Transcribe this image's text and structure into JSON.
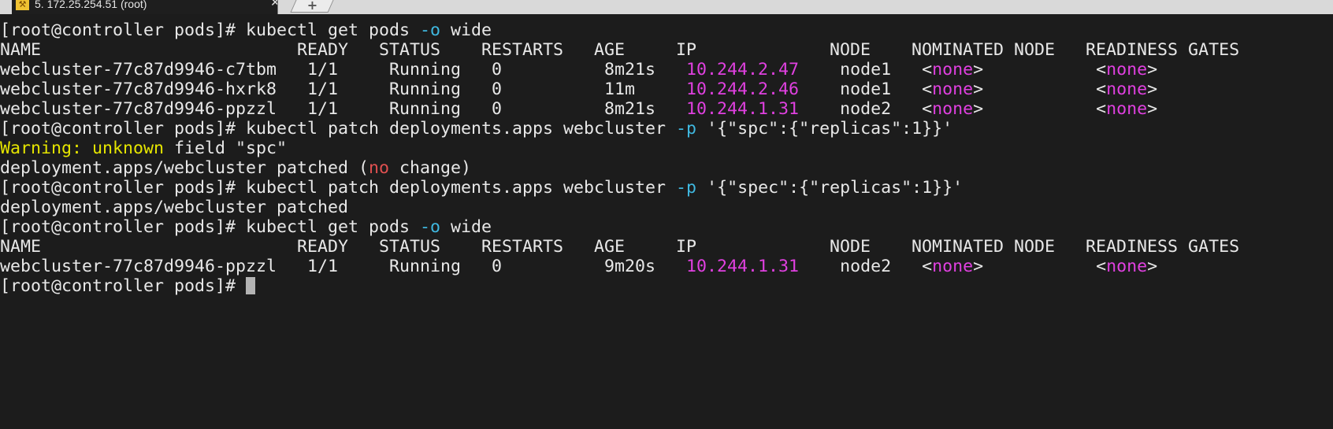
{
  "tab": {
    "title": "5. 172.25.254.51 (root)",
    "icon": "wrench-icon",
    "close": "✕",
    "new": "+"
  },
  "colors": {
    "background": "#1c1c1c",
    "text": "#e8e8e8",
    "ip": "#e040e0",
    "flag": "#3fb8e0",
    "warning": "#e5e500",
    "error": "#e05050"
  },
  "terminal": {
    "lines": [
      {
        "name": "command-line",
        "segments": [
          {
            "t": "[root@controller pods]# kubectl get pods "
          },
          {
            "t": "-o",
            "c": "cyan"
          },
          {
            "t": " wide"
          }
        ]
      },
      {
        "name": "table-header",
        "segments": [
          {
            "t": "NAME                         READY   STATUS    RESTARTS   AGE     IP             NODE    NOMINATED NODE   READINESS GATES"
          }
        ]
      },
      {
        "name": "pod-row",
        "segments": [
          {
            "t": "webcluster-77c87d9946-c7tbm   1/1     Running   0          8m21s   "
          },
          {
            "t": "10.244.2.47",
            "c": "magenta"
          },
          {
            "t": "    node1   <"
          },
          {
            "t": "none",
            "c": "magenta"
          },
          {
            "t": ">           <"
          },
          {
            "t": "none",
            "c": "magenta"
          },
          {
            "t": ">"
          }
        ]
      },
      {
        "name": "pod-row",
        "segments": [
          {
            "t": "webcluster-77c87d9946-hxrk8   1/1     Running   0          11m     "
          },
          {
            "t": "10.244.2.46",
            "c": "magenta"
          },
          {
            "t": "    node1   <"
          },
          {
            "t": "none",
            "c": "magenta"
          },
          {
            "t": ">           <"
          },
          {
            "t": "none",
            "c": "magenta"
          },
          {
            "t": ">"
          }
        ]
      },
      {
        "name": "pod-row",
        "segments": [
          {
            "t": "webcluster-77c87d9946-ppzzl   1/1     Running   0          8m21s   "
          },
          {
            "t": "10.244.1.31",
            "c": "magenta"
          },
          {
            "t": "    node2   <"
          },
          {
            "t": "none",
            "c": "magenta"
          },
          {
            "t": ">           <"
          },
          {
            "t": "none",
            "c": "magenta"
          },
          {
            "t": ">"
          }
        ]
      },
      {
        "name": "command-line",
        "segments": [
          {
            "t": "[root@controller pods]# kubectl patch deployments.apps webcluster "
          },
          {
            "t": "-p",
            "c": "cyan"
          },
          {
            "t": " '{\"spc\":{\"replicas\":1}}'"
          }
        ]
      },
      {
        "name": "warning-line",
        "segments": [
          {
            "t": "Warning: unknown",
            "c": "yellow"
          },
          {
            "t": " field \"spc\""
          }
        ]
      },
      {
        "name": "output-line",
        "segments": [
          {
            "t": "deployment.apps/webcluster patched ("
          },
          {
            "t": "no",
            "c": "red"
          },
          {
            "t": " change)"
          }
        ]
      },
      {
        "name": "command-line",
        "segments": [
          {
            "t": "[root@controller pods]# kubectl patch deployments.apps webcluster "
          },
          {
            "t": "-p",
            "c": "cyan"
          },
          {
            "t": " '{\"spec\":{\"replicas\":1}}'"
          }
        ]
      },
      {
        "name": "output-line",
        "segments": [
          {
            "t": "deployment.apps/webcluster patched"
          }
        ]
      },
      {
        "name": "command-line",
        "segments": [
          {
            "t": "[root@controller pods]# kubectl get pods "
          },
          {
            "t": "-o",
            "c": "cyan"
          },
          {
            "t": " wide"
          }
        ]
      },
      {
        "name": "table-header",
        "segments": [
          {
            "t": "NAME                         READY   STATUS    RESTARTS   AGE     IP             NODE    NOMINATED NODE   READINESS GATES"
          }
        ]
      },
      {
        "name": "pod-row",
        "segments": [
          {
            "t": "webcluster-77c87d9946-ppzzl   1/1     Running   0          9m20s   "
          },
          {
            "t": "10.244.1.31",
            "c": "magenta"
          },
          {
            "t": "    node2   <"
          },
          {
            "t": "none",
            "c": "magenta"
          },
          {
            "t": ">           <"
          },
          {
            "t": "none",
            "c": "magenta"
          },
          {
            "t": ">"
          }
        ]
      },
      {
        "name": "prompt-line",
        "segments": [
          {
            "t": "[root@controller pods]# "
          }
        ],
        "cursor": true
      }
    ]
  }
}
